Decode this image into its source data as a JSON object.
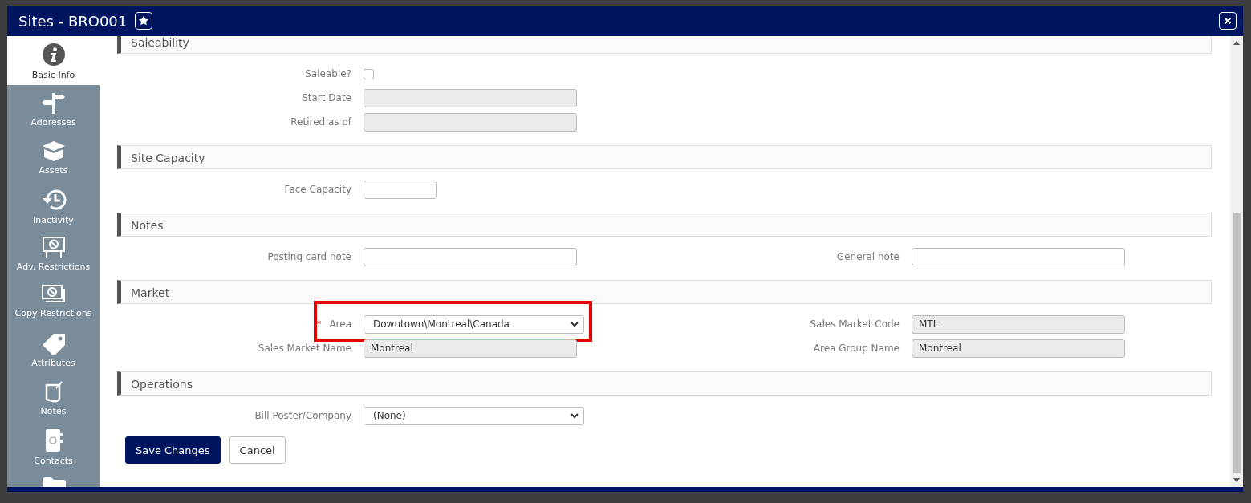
{
  "window": {
    "title": "Sites - BRO001"
  },
  "sidebar": {
    "items": [
      {
        "label": "Basic Info",
        "selected": true
      },
      {
        "label": "Addresses",
        "selected": false
      },
      {
        "label": "Assets",
        "selected": false
      },
      {
        "label": "Inactivity",
        "selected": false
      },
      {
        "label": "Adv. Restrictions",
        "selected": false
      },
      {
        "label": "Copy Restrictions",
        "selected": false
      },
      {
        "label": "Attributes",
        "selected": false
      },
      {
        "label": "Notes",
        "selected": false
      },
      {
        "label": "Contacts",
        "selected": false
      },
      {
        "selected": false
      }
    ]
  },
  "sections": [
    {
      "title": "Saleability",
      "rows": [
        {
          "left": {
            "label": "Saleable?",
            "kind": "checkbox",
            "checked": false
          }
        },
        {
          "left": {
            "label": "Start Date",
            "kind": "text",
            "disabled": true
          }
        },
        {
          "left": {
            "label": "Retired as of",
            "kind": "text",
            "disabled": true
          }
        }
      ]
    },
    {
      "title": "Site Capacity",
      "rows": [
        {
          "left": {
            "label": "Face Capacity",
            "kind": "short",
            "disabled": false
          }
        }
      ]
    },
    {
      "title": "Notes",
      "rows": [
        {
          "left": {
            "label": "Posting card note",
            "kind": "text",
            "disabled": false
          },
          "right": {
            "label": "General note",
            "kind": "text",
            "disabled": false
          }
        }
      ]
    },
    {
      "title": "Market",
      "rows": [
        {
          "left": {
            "label": "Area",
            "required_mark": "*",
            "kind": "dropdown",
            "value": "Downtown\\Montreal\\Canada",
            "highlighted": true
          },
          "right": {
            "label": "Sales Market Code",
            "kind": "text",
            "disabled": true,
            "value": "MTL"
          }
        },
        {
          "left": {
            "label": "Sales Market Name",
            "kind": "text",
            "disabled": true,
            "value": "Montreal"
          },
          "right": {
            "label": "Area Group Name",
            "kind": "text",
            "disabled": true,
            "value": "Montreal"
          }
        }
      ]
    },
    {
      "title": "Operations",
      "rows": [
        {
          "left": {
            "label": "Bill Poster/Company",
            "kind": "dropdown",
            "value": "(None)"
          }
        }
      ]
    }
  ],
  "buttons": [
    {
      "label": "Save Changes",
      "kind": "primary"
    },
    {
      "label": "Cancel",
      "kind": "secondary"
    }
  ]
}
